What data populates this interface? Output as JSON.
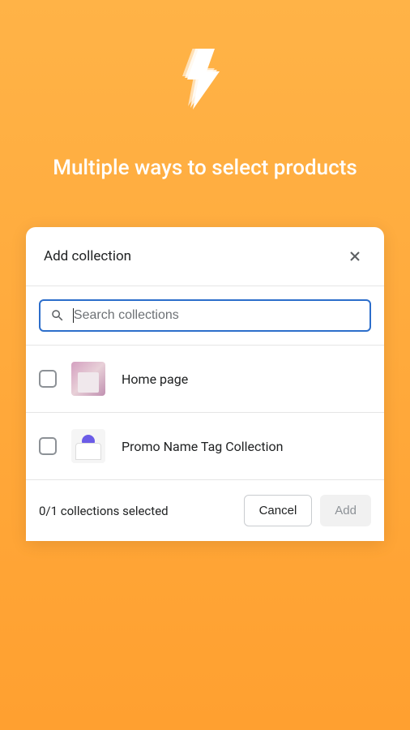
{
  "hero": {
    "title": "Multiple ways to select products"
  },
  "modal": {
    "title": "Add collection",
    "search": {
      "placeholder": "Search collections",
      "value": ""
    },
    "collections": [
      {
        "name": "Home page"
      },
      {
        "name": "Promo Name Tag Collection"
      }
    ],
    "footer": {
      "selection_text": "0/1 collections selected",
      "cancel_label": "Cancel",
      "add_label": "Add"
    }
  }
}
